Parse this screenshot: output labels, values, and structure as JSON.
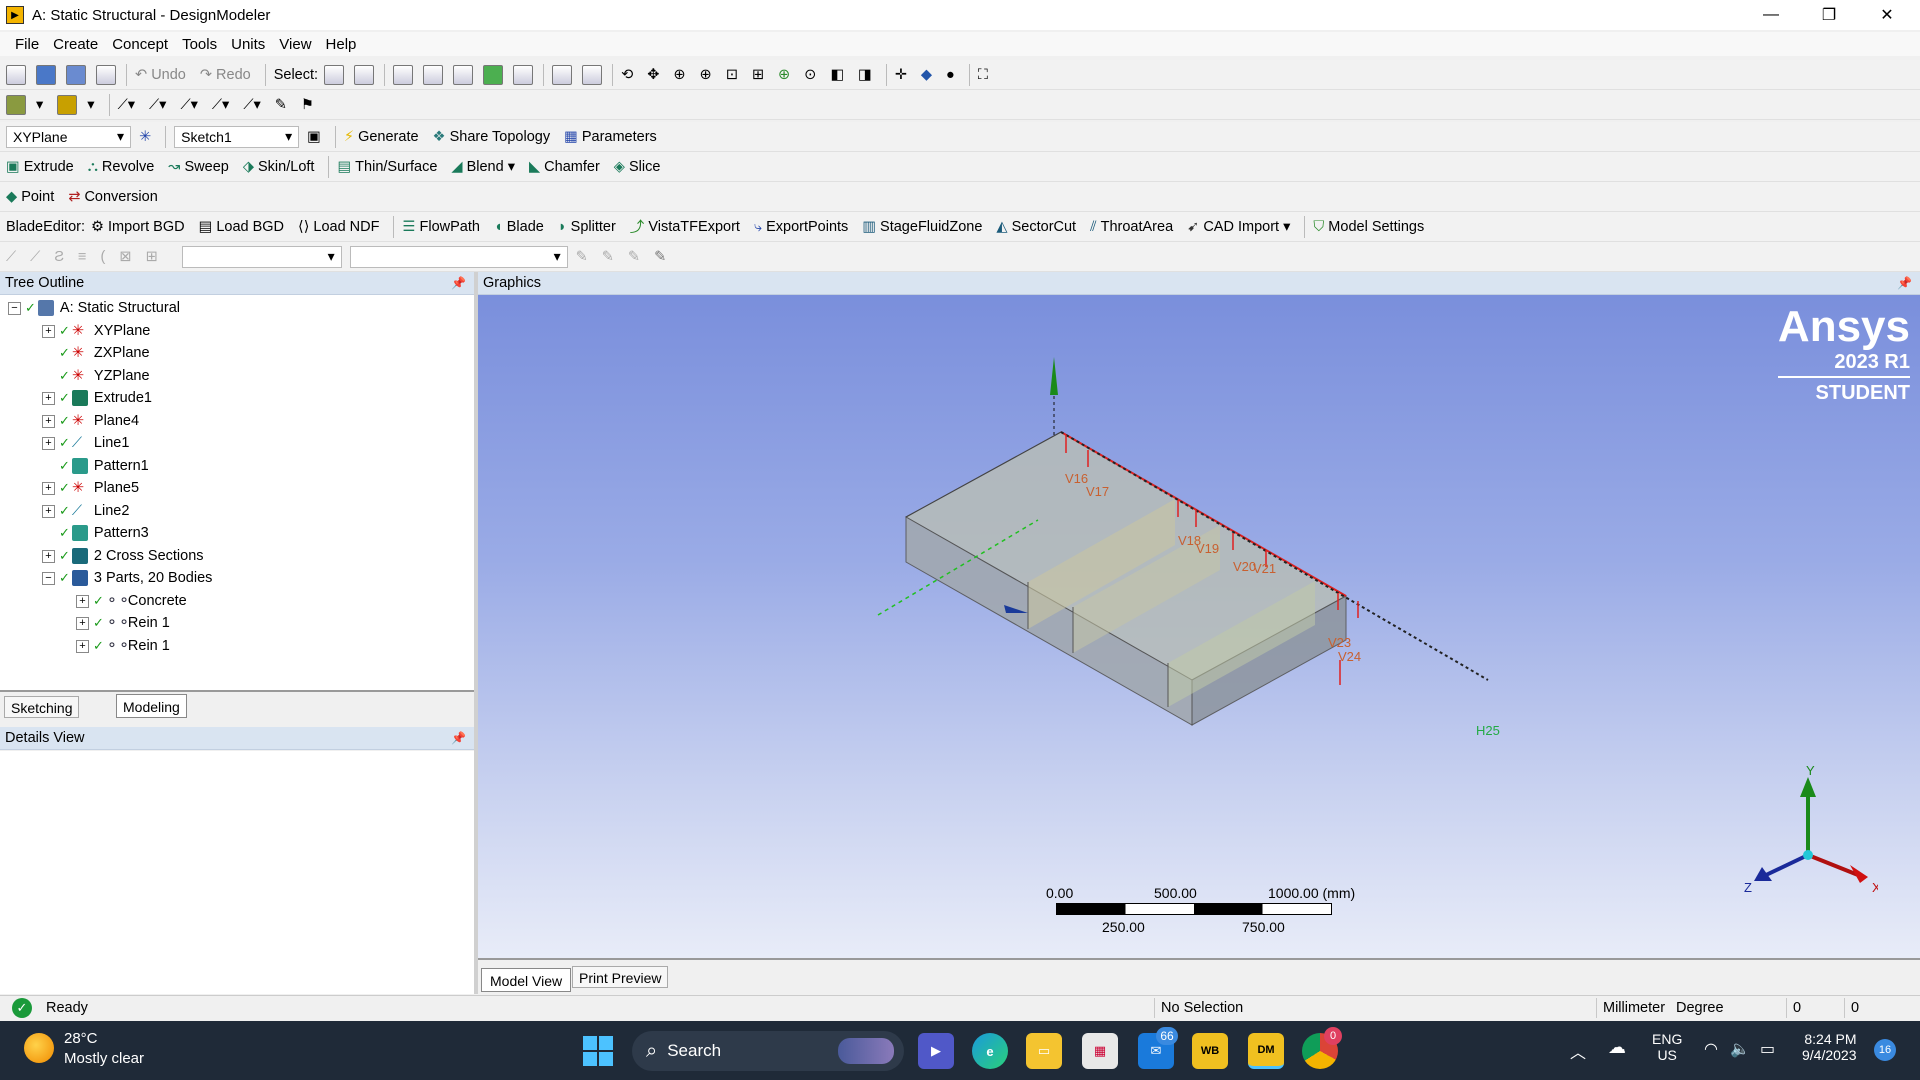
{
  "window": {
    "title": "A: Static Structural - DesignModeler",
    "app_icon": "ansys-dm-icon"
  },
  "menu": [
    "File",
    "Create",
    "Concept",
    "Tools",
    "Units",
    "View",
    "Help"
  ],
  "toolbar1": {
    "undo": "Undo",
    "redo": "Redo",
    "select_label": "Select:"
  },
  "toolbar3": {
    "plane": "XYPlane",
    "sketch": "Sketch1",
    "generate": "Generate",
    "share_topology": "Share Topology",
    "parameters": "Parameters"
  },
  "toolbar4": [
    "Extrude",
    "Revolve",
    "Sweep",
    "Skin/Loft",
    "Thin/Surface",
    "Blend",
    "Chamfer",
    "Slice"
  ],
  "toolbar5": [
    "Point",
    "Conversion"
  ],
  "toolbar6": {
    "label": "BladeEditor:",
    "items": [
      "Import BGD",
      "Load BGD",
      "Load NDF",
      "FlowPath",
      "Blade",
      "Splitter",
      "VistaTFExport",
      "ExportPoints",
      "StageFluidZone",
      "SectorCut",
      "ThroatArea",
      "CAD Import",
      "Model Settings"
    ]
  },
  "tree": {
    "header": "Tree Outline",
    "root": "A: Static Structural",
    "items": [
      "XYPlane",
      "ZXPlane",
      "YZPlane",
      "Extrude1",
      "Plane4",
      "Line1",
      "Pattern1",
      "Plane5",
      "Line2",
      "Pattern3",
      "2 Cross Sections",
      "3 Parts, 20 Bodies"
    ],
    "bodies": [
      "Concrete",
      "Rein 1",
      "Rein 1"
    ],
    "tabs": [
      "Sketching",
      "Modeling"
    ]
  },
  "details": {
    "header": "Details View"
  },
  "graphics": {
    "header": "Graphics",
    "brand": "Ansys",
    "version": "2023 R1",
    "edition": "STUDENT",
    "scale_top": [
      "0.00",
      "500.00",
      "1000.00 (mm)"
    ],
    "scale_bottom": [
      "250.00",
      "750.00"
    ],
    "axes": {
      "x": "X",
      "y": "Y",
      "z": "Z"
    },
    "labels": [
      "V16",
      "V17",
      "V18",
      "V19",
      "V20",
      "V21",
      "V23",
      "V24",
      "H25"
    ],
    "tabs": [
      "Model View",
      "Print Preview"
    ]
  },
  "status": {
    "ready": "Ready",
    "selection": "No Selection",
    "length_unit": "Millimeter",
    "angle_unit": "Degree",
    "val1": "0",
    "val2": "0"
  },
  "taskbar": {
    "weather_temp": "28°C",
    "weather_desc": "Mostly clear",
    "search": "Search",
    "mail_badge": "66",
    "chrome_badge": "0",
    "lang": "ENG",
    "region": "US",
    "time": "8:24 PM",
    "date": "9/4/2023",
    "notif": "16"
  }
}
